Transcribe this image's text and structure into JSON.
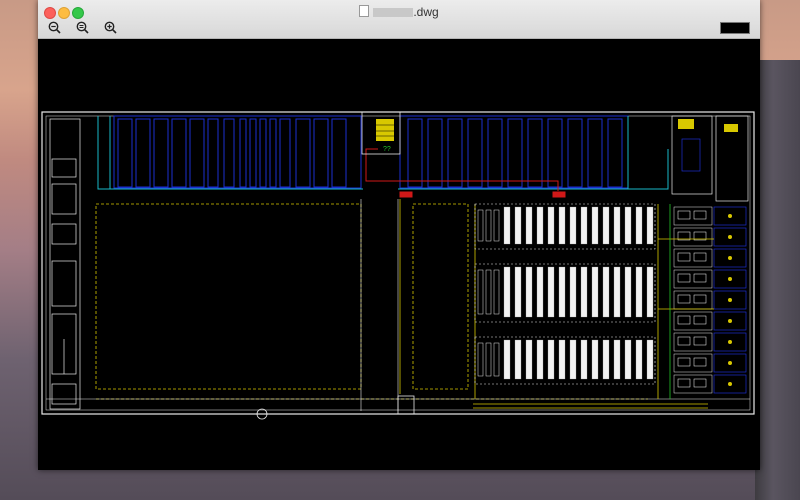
{
  "window": {
    "title_suffix": ".dwg",
    "file_icon": "document-icon"
  },
  "toolbar": {
    "tools": [
      {
        "icon": "zoom-out-icon",
        "label": "−"
      },
      {
        "icon": "zoom-fit-icon",
        "label": "="
      },
      {
        "icon": "zoom-in-icon",
        "label": "+"
      }
    ],
    "background_swatch": "#000000"
  },
  "drawing": {
    "labels": [
      "??"
    ],
    "colors": {
      "walls": "#e8e8e8",
      "zones": "#1c2fcf",
      "pipes": "#19b9c9",
      "grid": "#d8c800",
      "hvac": "#d01818",
      "green": "#22c42a"
    }
  }
}
